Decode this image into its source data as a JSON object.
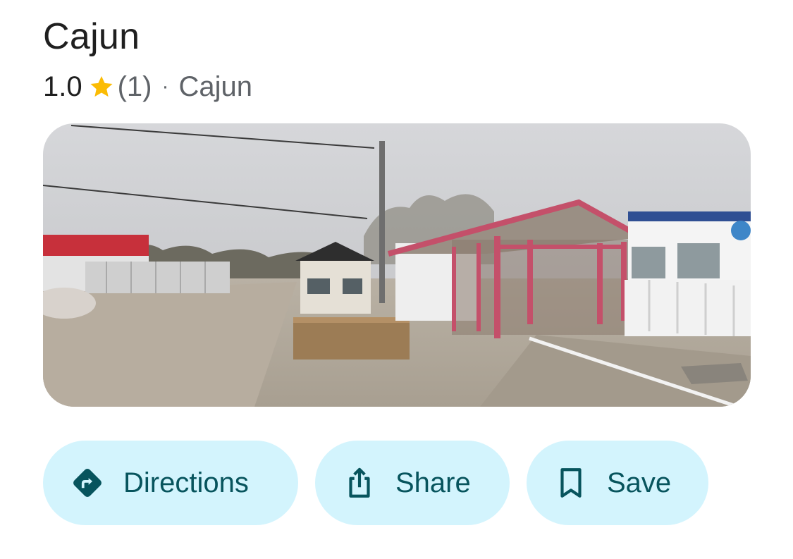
{
  "place": {
    "name": "Cajun",
    "rating": "1.0",
    "review_count": "(1)",
    "separator": "·",
    "category": "Cajun"
  },
  "photo": {
    "alt": "Street view of a roadside building with a red-framed covered patio and white fence"
  },
  "actions": {
    "directions_label": "Directions",
    "share_label": "Share",
    "save_label": "Save"
  },
  "colors": {
    "chip_bg": "#d3f4fd",
    "chip_fg": "#07545d",
    "star": "#fbbc04"
  },
  "icons": {
    "star": "star-icon",
    "directions": "directions-icon",
    "share": "share-icon",
    "save": "bookmark-icon"
  }
}
